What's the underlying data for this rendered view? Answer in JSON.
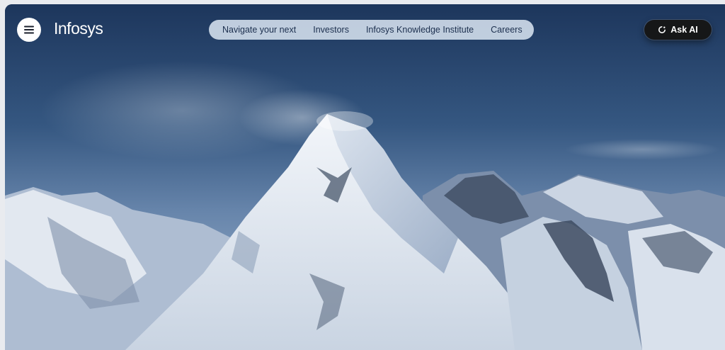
{
  "brand": {
    "logo_text": "Infosys"
  },
  "header": {
    "menu_icon": "hamburger-menu-icon",
    "nav_links": [
      {
        "label": "Navigate your next"
      },
      {
        "label": "Investors"
      },
      {
        "label": "Infosys Knowledge Institute"
      },
      {
        "label": "Careers"
      }
    ],
    "ask_ai": {
      "label": "Ask AI",
      "icon": "ai-sparkle-icon"
    }
  },
  "hero": {
    "image": "snowy-mountain-peak-photo"
  },
  "colors": {
    "sky_top": "#1f3b63",
    "nav_pill_bg": "#cedae8",
    "nav_text": "#1c2f4e",
    "ask_ai_bg": "#161718",
    "snow": "#e8edf3"
  }
}
